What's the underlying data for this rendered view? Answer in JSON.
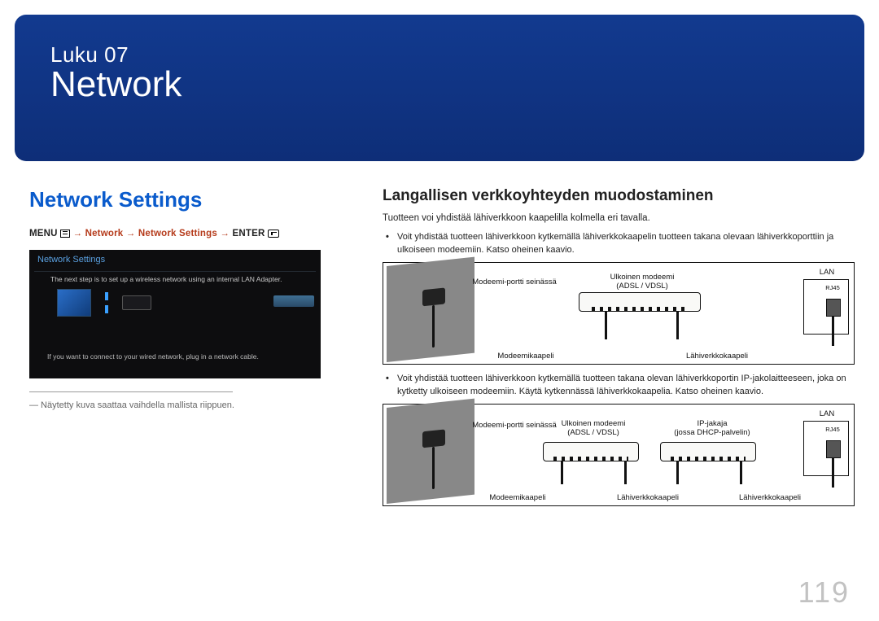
{
  "chapter_label": "Luku 07",
  "chapter_title": "Network",
  "page_number": "119",
  "left": {
    "section_title": "Network Settings",
    "menu_word": "MENU",
    "path_nav": " → Network → Network Settings → ",
    "enter_word": "ENTER",
    "screenshot": {
      "title": "Network Settings",
      "body": "The next step is to set up a wireless network using an internal LAN Adapter.",
      "bottom": "If you want to connect to your wired network, plug in a network cable."
    },
    "footnote": "― Näytetty kuva saattaa vaihdella mallista riippuen."
  },
  "right": {
    "heading": "Langallisen verkkoyhteyden muodostaminen",
    "intro": "Tuotteen voi yhdistää lähiverkkoon kaapelilla kolmella eri tavalla.",
    "bullet1": "Voit yhdistää tuotteen lähiverkkoon kytkemällä lähiverkkokaapelin tuotteen takana olevaan lähiverkkoporttiin ja ulkoiseen modeemiin. Katso oheinen kaavio.",
    "bullet2": "Voit yhdistää tuotteen lähiverkkoon kytkemällä tuotteen takana olevan lähiverkkoportin IP-jakolaitteeseen, joka on kytketty ulkoiseen modeemiin. Käytä kytkennässä lähiverkkokaapelia. Katso oheinen kaavio.",
    "labels": {
      "wall": "Modeemi-portti seinässä",
      "ext_modem": "Ulkoinen modeemi",
      "adsl": "(ADSL / VDSL)",
      "lan": "LAN",
      "rj45": "RJ45",
      "modem_cable": "Modeemikaapeli",
      "lan_cable": "Lähiverkkokaapeli",
      "ip_router": "IP-jakaja",
      "dhcp": "(jossa DHCP-palvelin)"
    }
  }
}
